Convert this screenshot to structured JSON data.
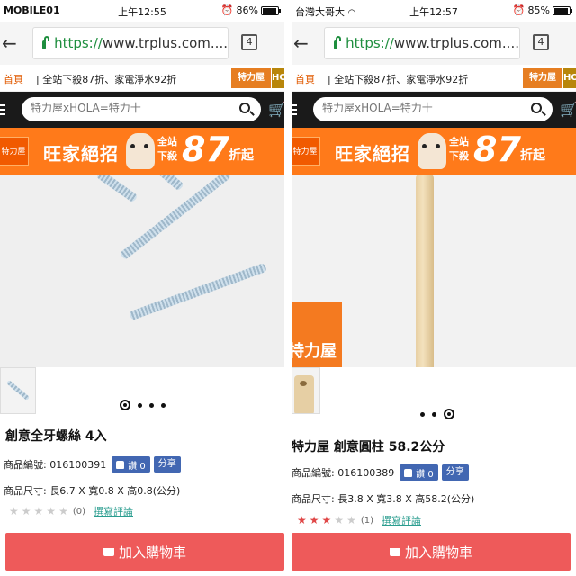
{
  "panels": [
    {
      "status": {
        "carrier": "MOBILE01",
        "time": "上午12:55",
        "alarm": "⏰",
        "battery": "86%",
        "battery_level": 0.86
      },
      "url": {
        "scheme": "https://",
        "host": "www.trplus.com....",
        "tab_count": "4"
      },
      "nav": {
        "home": "首頁",
        "promo": "| 全站下殺87折、家電淨水92折",
        "badge1": "特力屋",
        "badge2": "HOLA"
      },
      "search": {
        "placeholder": "特力屋xHOLA=特力十"
      },
      "banner": {
        "logo": "特力屋",
        "title": "旺家絕招",
        "site": "全站下殺",
        "number": "87",
        "suffix": "折起"
      },
      "product": {
        "title": "創意全牙螺絲 4入",
        "sku_label": "商品編號: 016100391",
        "like_label": "讚 0",
        "share_label": "分享",
        "size_label": "商品尺寸: 長6.7 X 寬0.8 X 高0.8(公分)",
        "stars_filled": 0,
        "review_count": "(0)",
        "review_link": "撰寫評論",
        "cart_label": "加入購物車",
        "carousel_active": 0
      }
    },
    {
      "status": {
        "carrier": "台灣大哥大",
        "time": "上午12:57",
        "alarm": "⏰",
        "battery": "85%",
        "battery_level": 0.85
      },
      "url": {
        "scheme": "https://",
        "host": "www.trplus.com....",
        "tab_count": "4"
      },
      "nav": {
        "home": "首頁",
        "promo": "| 全站下殺87折、家電淨水92折",
        "badge1": "特力屋",
        "badge2": "HOLA"
      },
      "search": {
        "placeholder": "特力屋xHOLA=特力十"
      },
      "banner": {
        "logo": "特力屋",
        "title": "旺家絕招",
        "site": "全站下殺",
        "number": "87",
        "suffix": "折起"
      },
      "product": {
        "title": "特力屋 創意圓柱 58.2公分",
        "sku_label": "商品編號: 016100389",
        "like_label": "讚 0",
        "share_label": "分享",
        "size_label": "商品尺寸: 長3.8 X 寬3.8 X 高58.2(公分)",
        "stars_filled": 3,
        "review_count": "(1)",
        "review_link": "撰寫評論",
        "cart_label": "加入購物車",
        "carousel_active": 2,
        "image_stamp": "特力屋"
      }
    }
  ],
  "colors": {
    "accent": "#ff7a1a",
    "cart": "#ee5a5a",
    "facebook": "#4267b2",
    "star_on": "#e04848",
    "star_off": "#cccccc",
    "link": "#2a9d8f"
  }
}
